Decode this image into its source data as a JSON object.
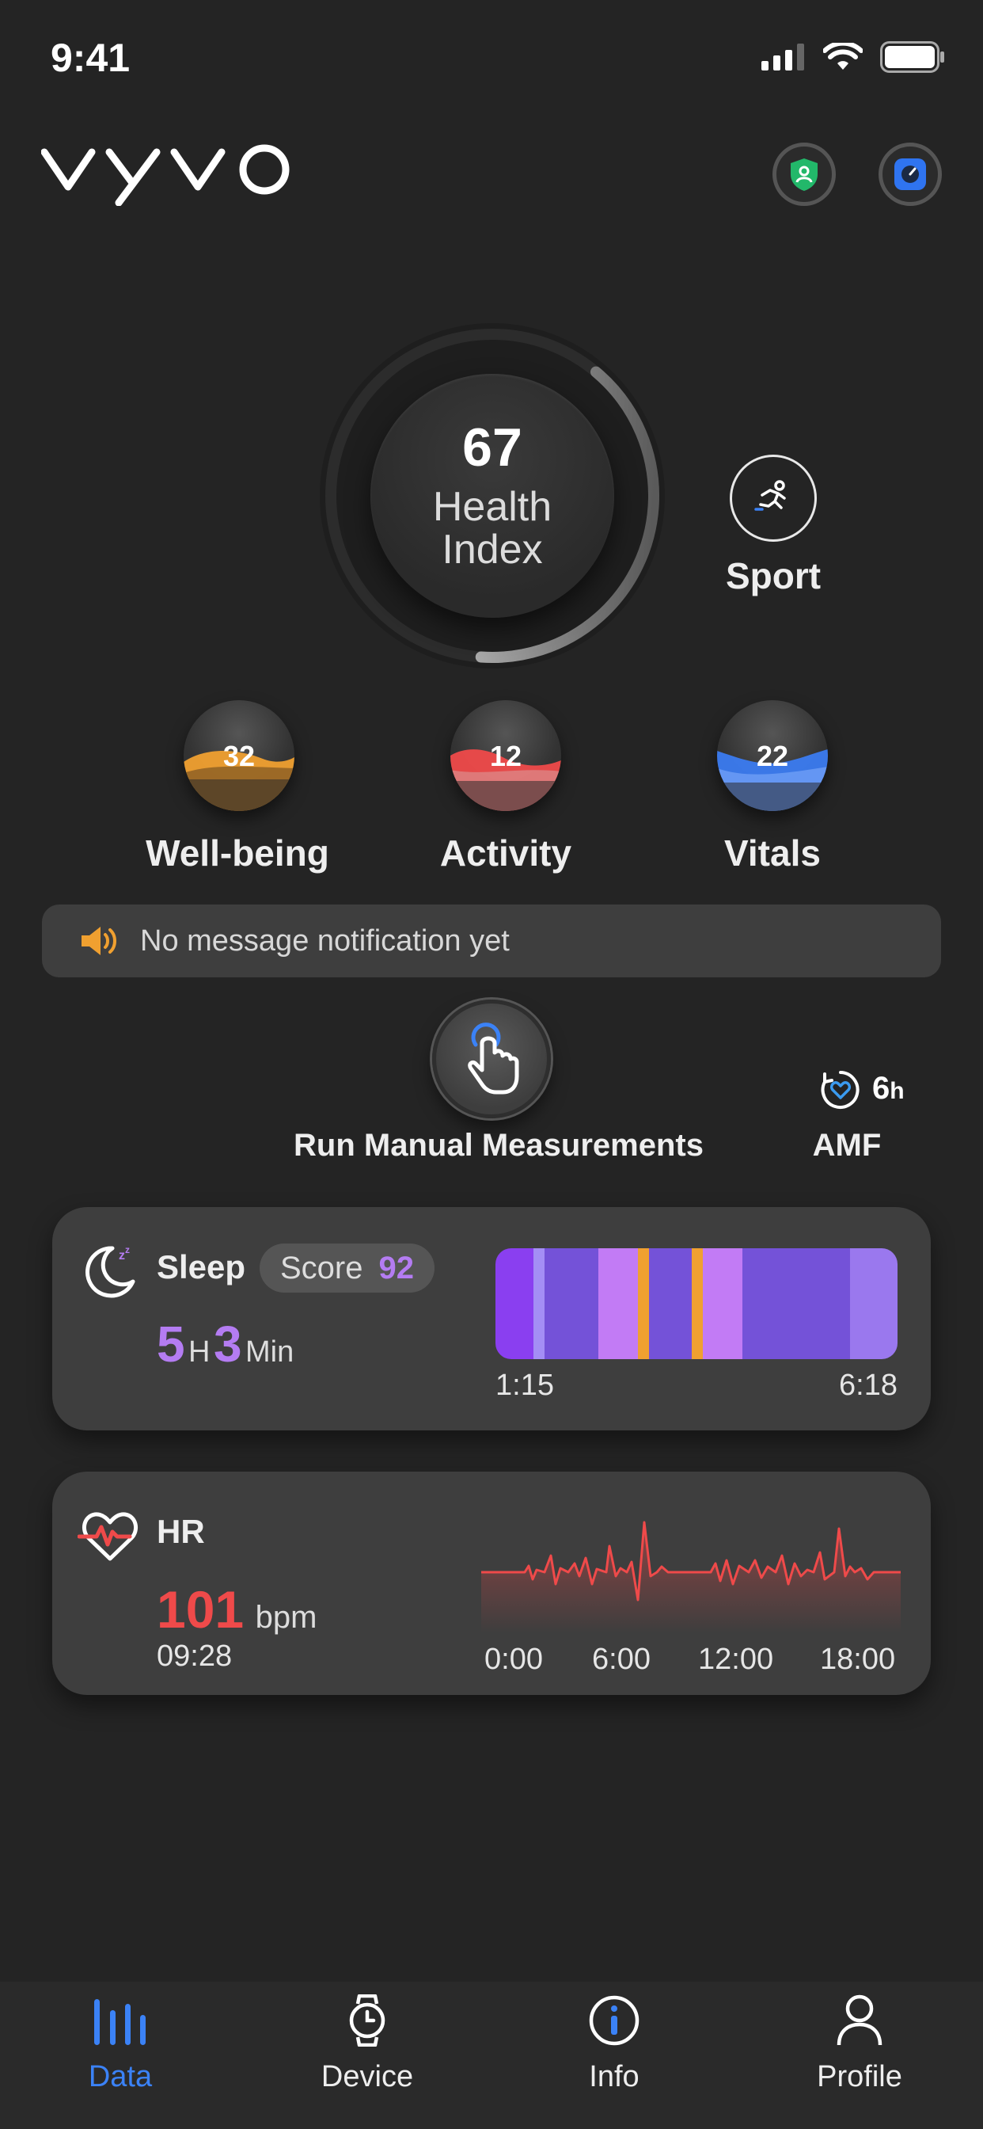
{
  "status_bar": {
    "time": "9:41"
  },
  "header": {
    "logo": "vyvo"
  },
  "health_index": {
    "value": "67",
    "label": "Health\nIndex",
    "progress_fraction": 0.4
  },
  "sport": {
    "label": "Sport"
  },
  "scores": [
    {
      "value": "32",
      "label": "Well-being",
      "color": "#f0a030"
    },
    {
      "value": "12",
      "label": "Activity",
      "color": "#ef4a4a"
    },
    {
      "value": "22",
      "label": "Vitals",
      "color": "#3b7bf0"
    }
  ],
  "notification": {
    "text": "No message notification yet"
  },
  "manual_measure": {
    "label": "Run Manual Measurements"
  },
  "amf": {
    "value": "6",
    "unit": "h",
    "label": "AMF"
  },
  "sleep": {
    "title": "Sleep",
    "score_label": "Score",
    "score": "92",
    "hours": "5",
    "hours_unit": "H",
    "minutes": "3",
    "minutes_unit": "Min",
    "start": "1:15",
    "end": "6:18"
  },
  "hr": {
    "title": "HR",
    "value": "101",
    "unit": "bpm",
    "time": "09:28",
    "axis": [
      "0:00",
      "6:00",
      "12:00",
      "18:00"
    ]
  },
  "tabs": [
    {
      "label": "Data",
      "active": true
    },
    {
      "label": "Device",
      "active": false
    },
    {
      "label": "Info",
      "active": false
    },
    {
      "label": "Profile",
      "active": false
    }
  ],
  "colors": {
    "accent": "#3b82f6",
    "purple": "#b47cf2",
    "red": "#ef4a4a"
  }
}
